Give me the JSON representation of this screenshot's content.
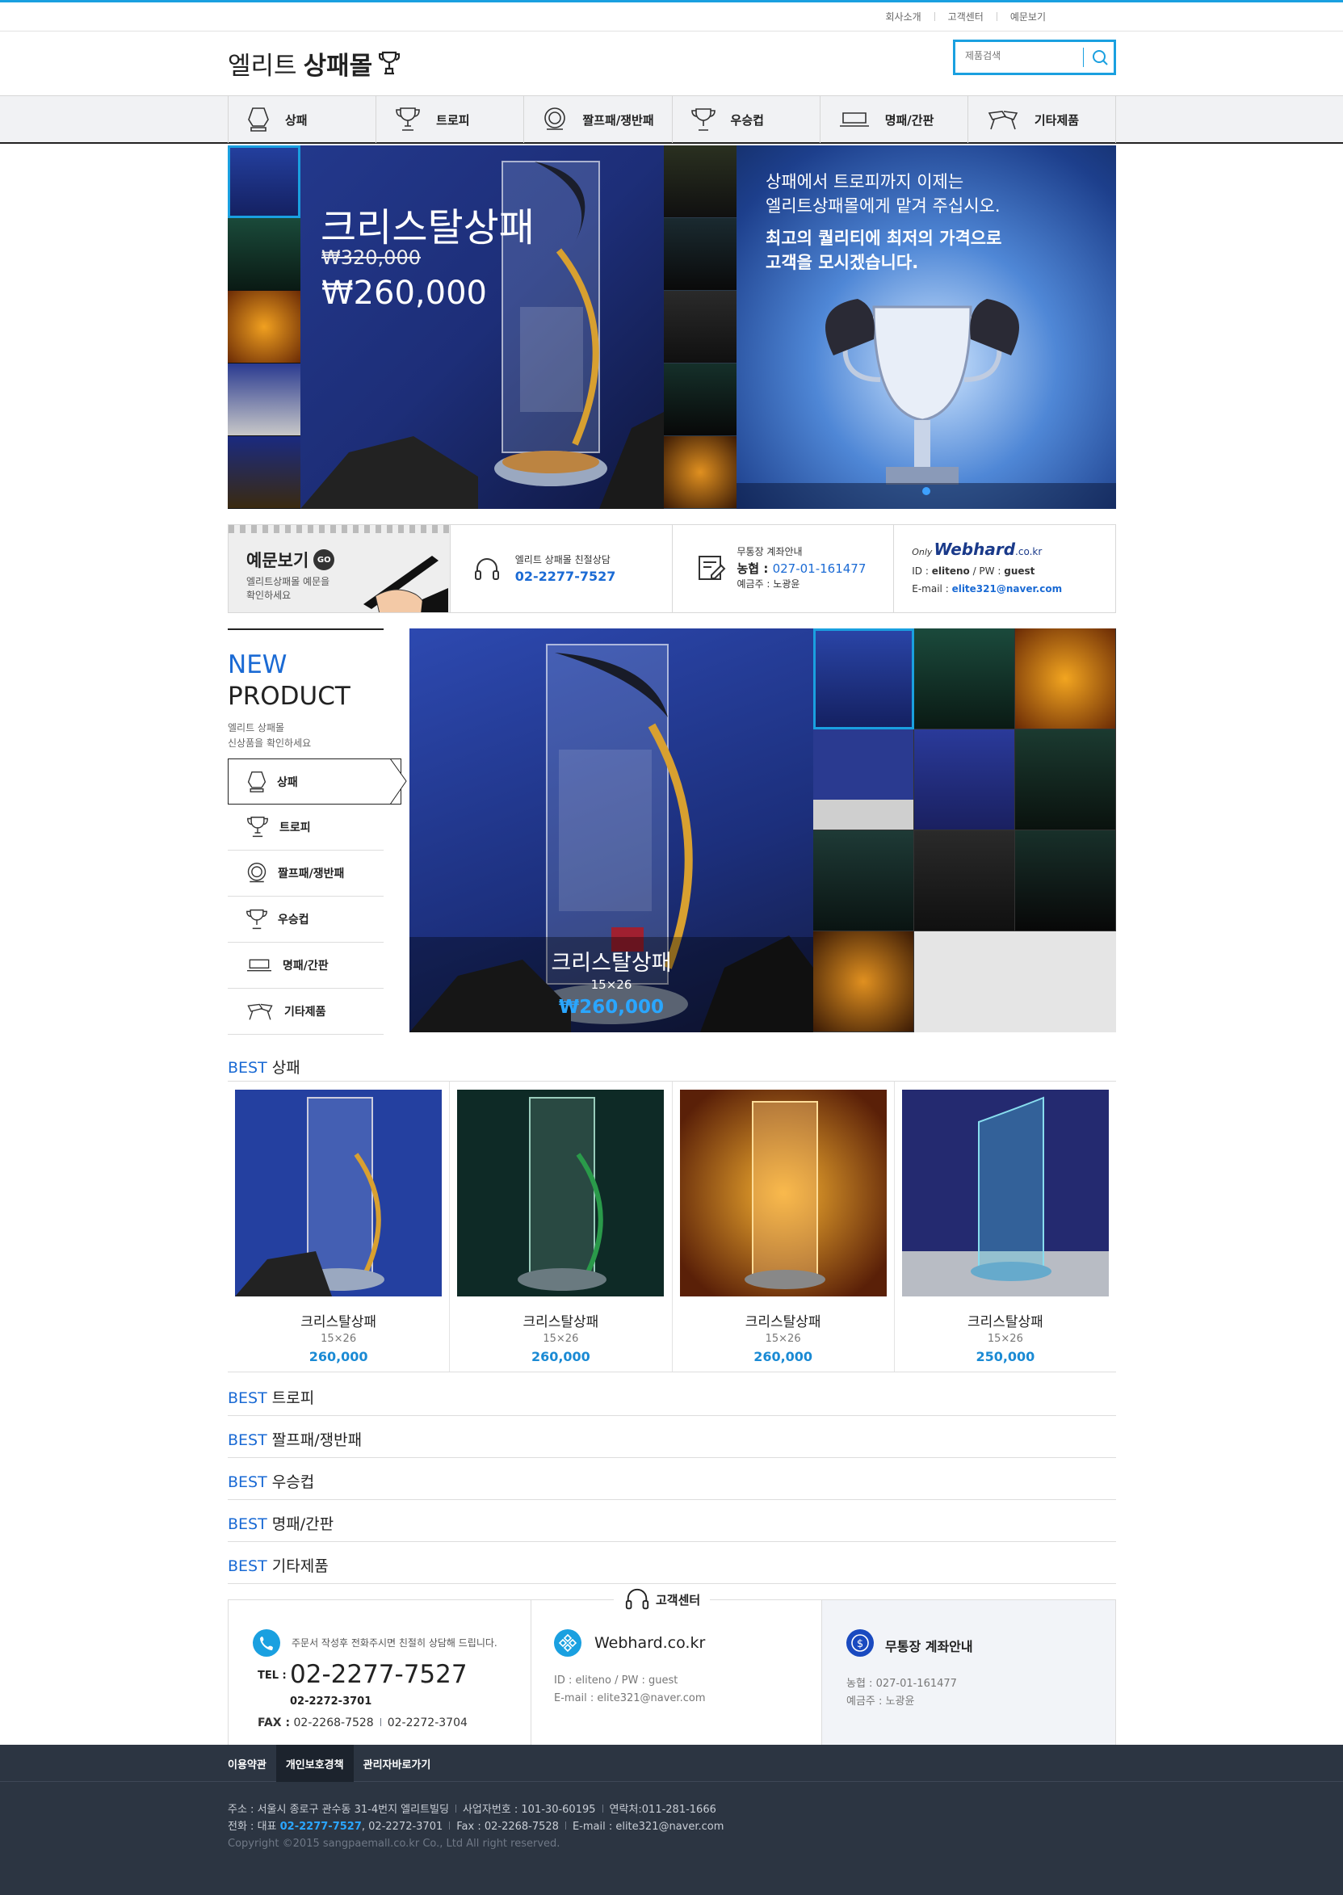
{
  "util_links": [
    "회사소개",
    "고객센터",
    "예문보기"
  ],
  "logo": {
    "part1": "엘리트",
    "part2": "상패몰"
  },
  "search": {
    "placeholder": "제품검색"
  },
  "gnb": [
    "상패",
    "트로피",
    "짤프패/쟁반패",
    "우승컵",
    "명패/간판",
    "기타제품"
  ],
  "hero_left": {
    "title": "크리스탈상패",
    "old_price": "₩320,000",
    "new_price": "₩260,000"
  },
  "hero_right": {
    "line1": "상패에서 트로피까지 이제는",
    "line2": "엘리트상패몰에게 맡겨 주십시오.",
    "line3": "최고의 퀄리티에 최저의 가격으로",
    "line4": "고객을 모시겠습니다."
  },
  "strip": {
    "sample": {
      "title": "예문보기",
      "go": "GO",
      "desc1": "엘리트상패몰 예문을",
      "desc2": "확인하세요"
    },
    "consult": {
      "label": "엘리트 상패몰 친절상담",
      "phone": "02-2277-7527"
    },
    "bank": {
      "label": "무통장 계좌안내",
      "bank": "농협 :",
      "account": "027-01-161477",
      "holder": "예금주 : 노광윤"
    },
    "webhard": {
      "only": "Only",
      "brand": "Webhard",
      "tld": ".co.kr",
      "id_label": "ID :",
      "id": "eliteno",
      "pw_label": "/ PW :",
      "pw": "guest",
      "email_label": "E-mail :",
      "email": "elite321@naver.com"
    }
  },
  "new_product": {
    "word1": "NEW",
    "word2": "PRODUCT",
    "desc1": "엘리트 상패몰",
    "desc2": "신상품을 확인하세요",
    "categories": [
      "상패",
      "트로피",
      "짤프패/쟁반패",
      "우승컵",
      "명패/간판",
      "기타제품"
    ],
    "featured": {
      "name": "크리스탈상패",
      "size": "15×26",
      "price": "₩260,000"
    }
  },
  "best_sections": [
    {
      "prefix": "BEST",
      "name": "상패"
    },
    {
      "prefix": "BEST",
      "name": "트로피"
    },
    {
      "prefix": "BEST",
      "name": "짤프패/쟁반패"
    },
    {
      "prefix": "BEST",
      "name": "우승컵"
    },
    {
      "prefix": "BEST",
      "name": "명패/간판"
    },
    {
      "prefix": "BEST",
      "name": "기타제품"
    }
  ],
  "best_products": [
    {
      "name": "크리스탈상패",
      "size": "15×26",
      "price": "260,000"
    },
    {
      "name": "크리스탈상패",
      "size": "15×26",
      "price": "260,000"
    },
    {
      "name": "크리스탈상패",
      "size": "15×26",
      "price": "260,000"
    },
    {
      "name": "크리스탈상패",
      "size": "15×26",
      "price": "250,000"
    }
  ],
  "customer_center": {
    "title": "고객센터",
    "phone_note": "주문서 작성후 전화주시면 친절히 상담해 드립니다.",
    "tel_label": "TEL :",
    "tel_main": "02-2277-7527",
    "tel_sub": "02-2272-3701",
    "fax_label": "FAX :",
    "fax1": "02-2268-7528",
    "fax2": "02-2272-3704",
    "webhard_title": "Webhard.co.kr",
    "webhard_id": "ID : eliteno / PW : guest",
    "webhard_email": "E-mail : elite321@naver.com",
    "bank_title": "무통장 계좌안내",
    "bank_account": "농협 : 027-01-161477",
    "bank_holder": "예금주 : 노광윤"
  },
  "footer": {
    "links": [
      "이용약관",
      "개인보호경책",
      "관리자바로가기"
    ],
    "address": "주소 : 서울시 종로구 관수동 31-4번지 엘리트빌딩",
    "bizno": "사업자번호 : 101-30-60195",
    "contact": "연락처:011-281-1666",
    "phone_label": "전화 : 대표",
    "phone_main": "02-2277-7527",
    "phone_sub": ", 02-2272-3701",
    "fax": "Fax : 02-2268-7528",
    "email": "E-mail : elite321@naver.com",
    "copyright": "Copyright ©2015 sangpaemall.co.kr Co., Ltd All right reserved."
  },
  "colors": {
    "accent": "#1aa0e0",
    "blue_text": "#1a6ad4",
    "footer_bg": "#2c3542"
  }
}
